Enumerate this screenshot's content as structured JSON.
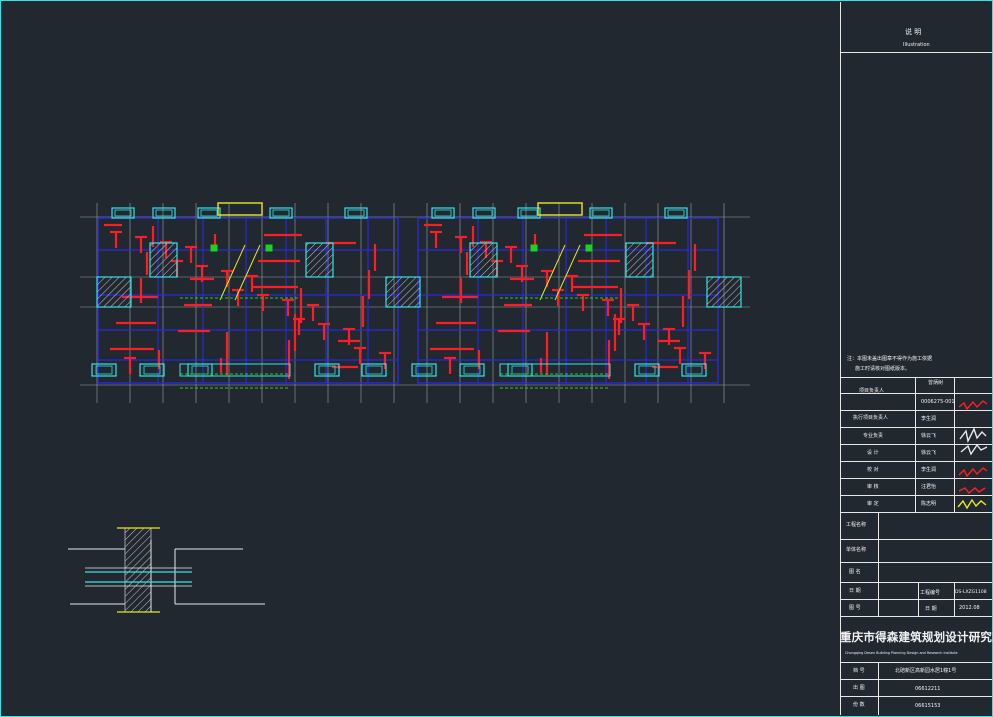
{
  "titleblock": {
    "heading": "说 明",
    "heading_en": "Illustration",
    "note_line1": "注：本图未盖出图章不得作为施工依据",
    "note_line2": "施工时请核对图纸版本。",
    "rows": [
      {
        "label": "项目负责人",
        "name": "曾炳树"
      },
      {
        "label": "",
        "name": "0006275-001"
      },
      {
        "label": "执行项目负责人",
        "name": "李生润"
      },
      {
        "label": "专业负责",
        "name": "徐云飞"
      },
      {
        "label": "设 计",
        "name": "徐云飞"
      },
      {
        "label": "校 对",
        "name": "李生润"
      },
      {
        "label": "审 核",
        "name": "汪君怡"
      },
      {
        "label": "审 定",
        "name": "陈志明"
      }
    ],
    "project_name_label": "工程名称",
    "unit_name_label": "单体名称",
    "drawing_name_label": "图 名",
    "date_label": "日 期",
    "drawing_no_label": "图 号",
    "project_no_label": "工程编号",
    "project_no_value": "DS-LXZG1108",
    "date_short_label": "日 期",
    "date_value": "2012.08",
    "institute_cn": "重庆市得森建筑规划设计研究院",
    "institute_en": "Chongqing Desen Building Planning Design and Research Institute",
    "bottom_rows": [
      {
        "label": "档 号",
        "value": "北碚新区高新园水居1幢1号"
      },
      {
        "label": "出 图",
        "value": "06612211"
      },
      {
        "label": "份 数",
        "value": "06615153"
      }
    ]
  },
  "colors": {
    "background": "#212830",
    "border": "#35e3e6",
    "wall": "#ff1d25",
    "grid_line": "#2a2ad8",
    "beam_cyan": "#35e3e6",
    "green": "#1fd11f",
    "yellow": "#e8e820",
    "gray": "#9aa0a6",
    "white": "#e8e8e8"
  },
  "icons": [
    "hatched-column-icon",
    "signature-icon"
  ]
}
